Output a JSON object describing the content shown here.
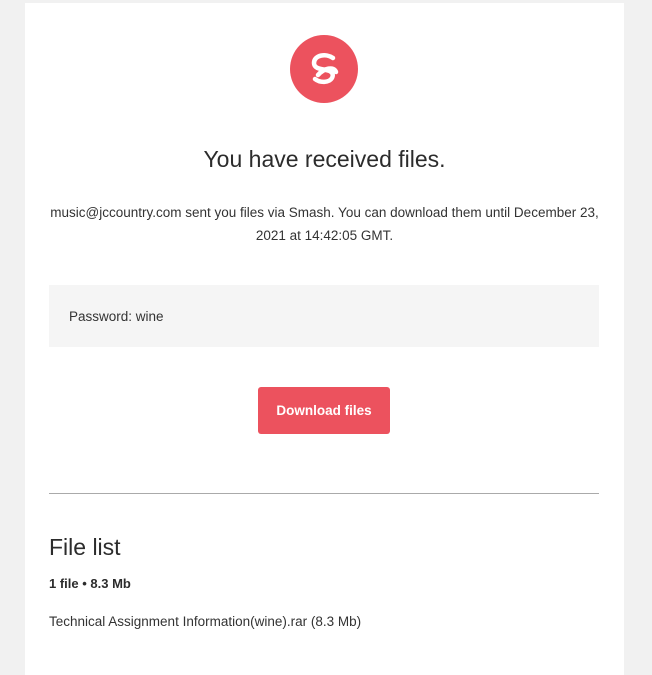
{
  "logo": {
    "icon": "smash-logo-icon",
    "color": "#ec525e"
  },
  "headline": "You have received files.",
  "description": "music@jccountry.com sent you files via Smash. You can download them until December 23, 2021 at 14:42:05 GMT.",
  "password": {
    "text": "Password: wine"
  },
  "download_button": {
    "label": "Download files",
    "color": "#ec525e"
  },
  "file_list": {
    "title": "File list",
    "summary": "1 file • 8.3 Mb",
    "items": [
      {
        "label": "Technical Assignment Information(wine).rar (8.3 Mb)"
      }
    ]
  }
}
